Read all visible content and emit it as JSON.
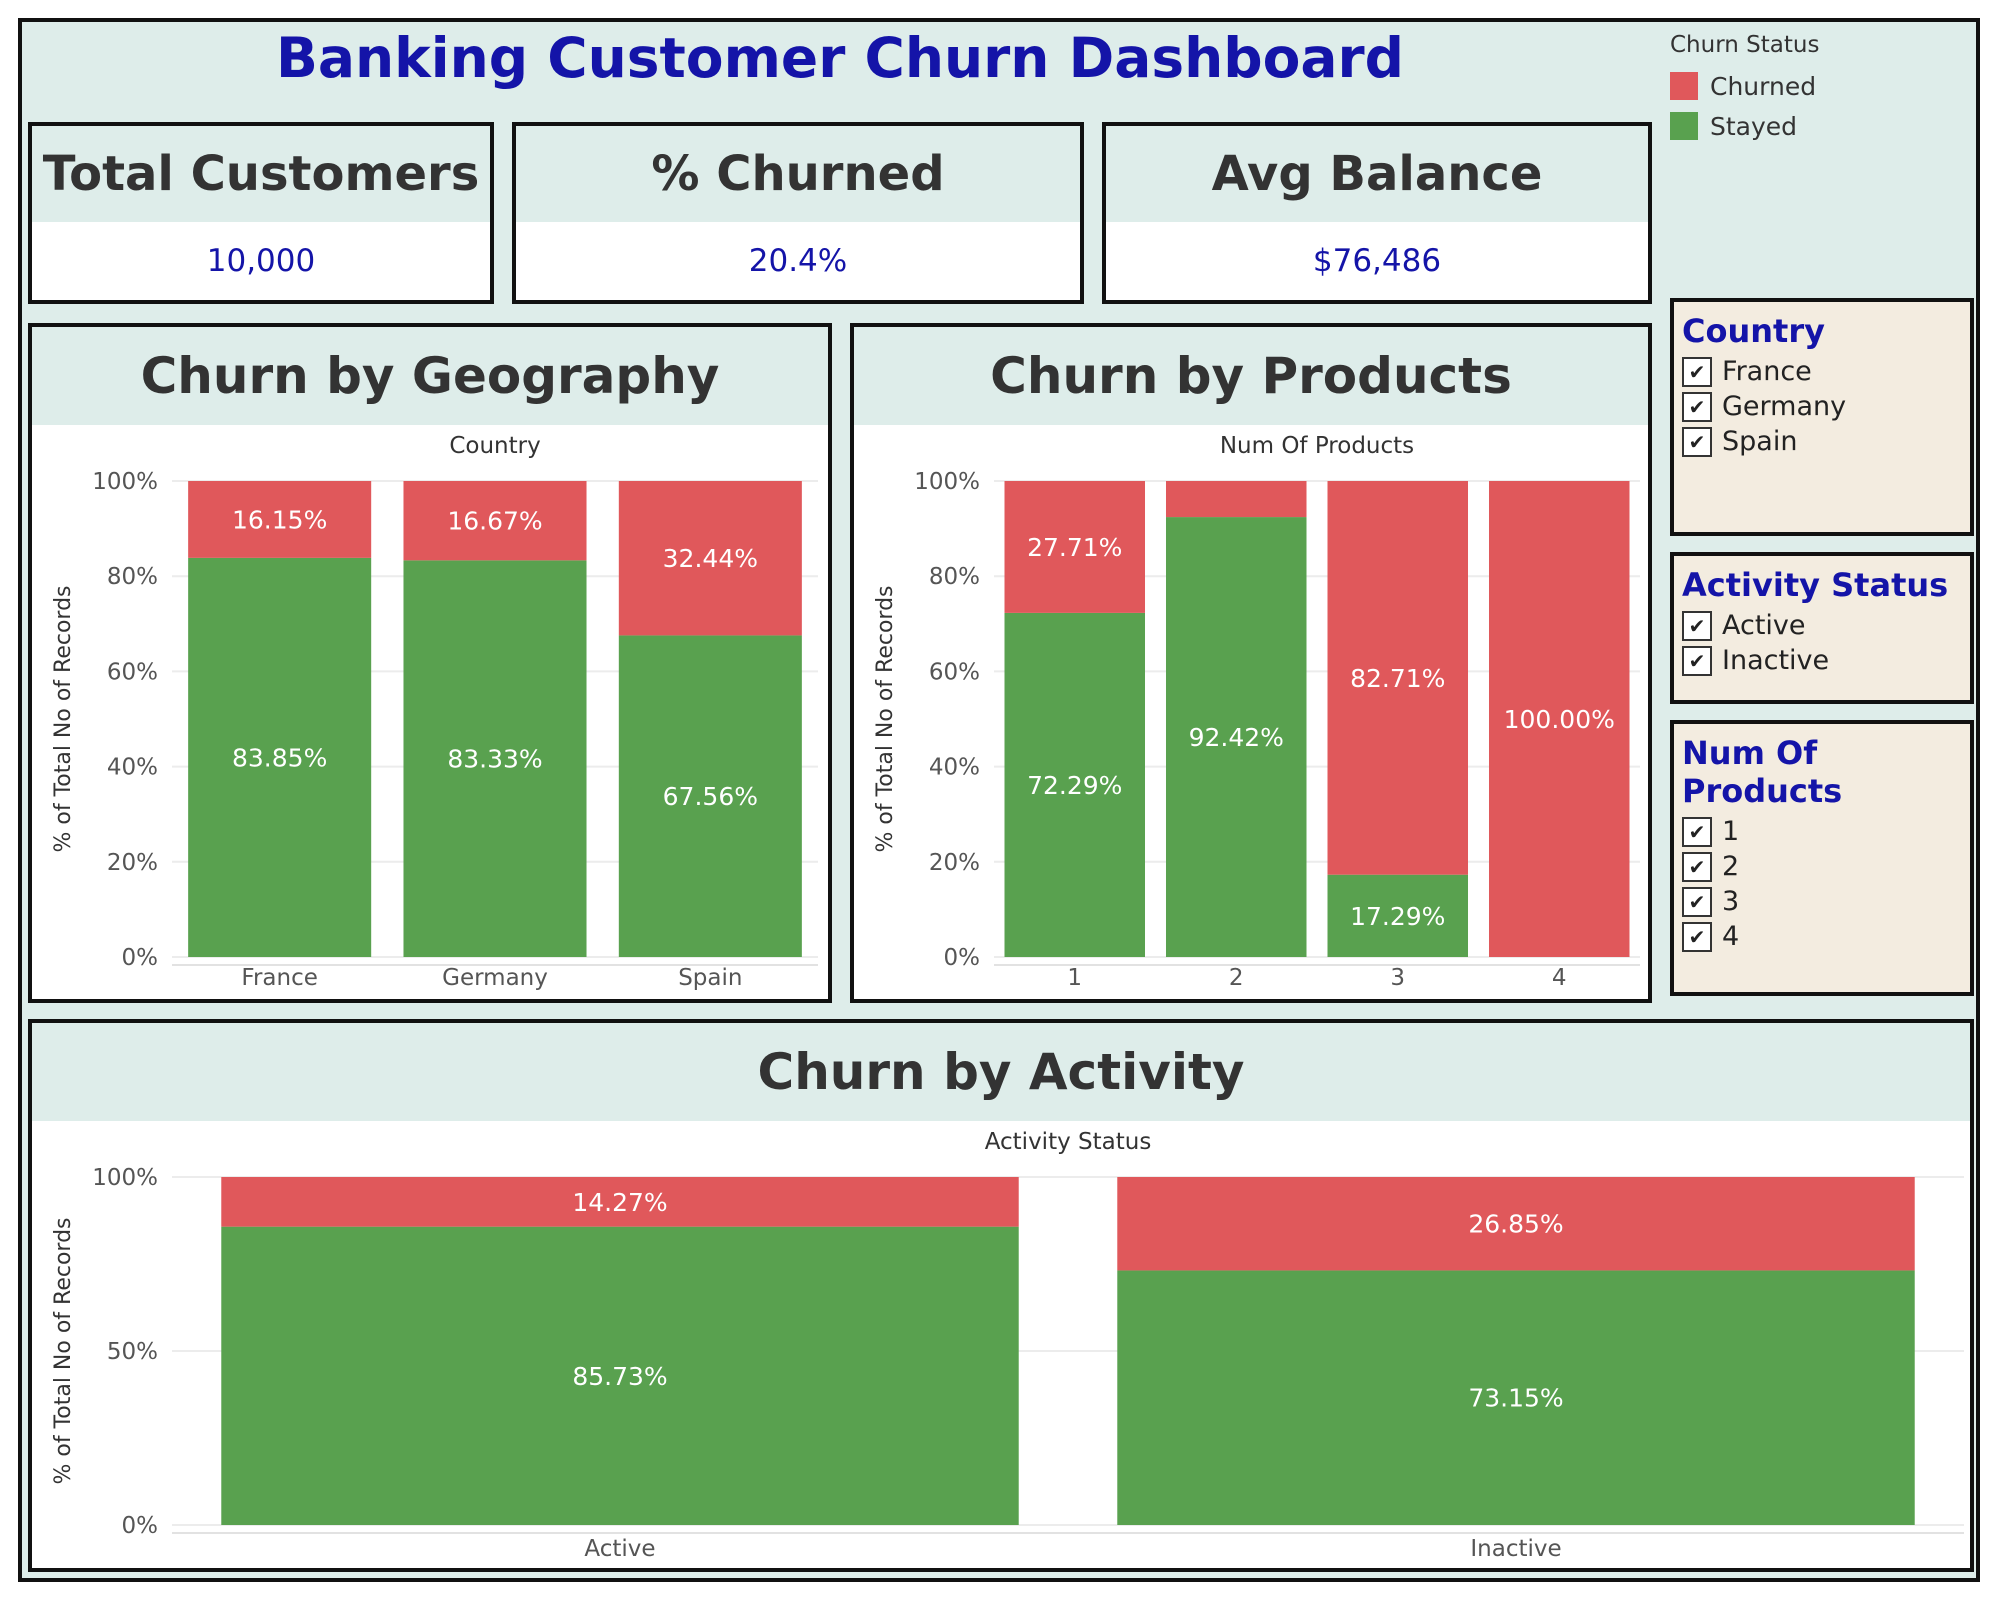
{
  "dashboard": {
    "title": "Banking Customer Churn Dashboard"
  },
  "legend": {
    "title": "Churn Status",
    "items": [
      {
        "label": "Churned",
        "color": "#e0585b"
      },
      {
        "label": "Stayed",
        "color": "#59a14f"
      }
    ]
  },
  "kpis": [
    {
      "label": "Total Customers",
      "value": "10,000"
    },
    {
      "label": "% Churned",
      "value": "20.4%"
    },
    {
      "label": "Avg Balance",
      "value": "$76,486"
    }
  ],
  "filters": [
    {
      "title": "Country",
      "items": [
        "France",
        "Germany",
        "Spain"
      ]
    },
    {
      "title": "Activity Status",
      "items": [
        "Active",
        "Inactive"
      ]
    },
    {
      "title": "Num Of Products",
      "items": [
        "1",
        "2",
        "3",
        "4"
      ]
    }
  ],
  "check_glyph": "✔",
  "colors": {
    "churned": "#e0585b",
    "stayed": "#59a14f",
    "accent": "#1414a8",
    "header_bg": "#deedea",
    "filter_bg": "#f3ece0"
  },
  "panels": {
    "geography": {
      "title": "Churn by Geography"
    },
    "products": {
      "title": "Churn by Products"
    },
    "activity": {
      "title": "Churn by Activity"
    }
  },
  "chart_data": [
    {
      "type": "bar",
      "stacked": true,
      "xlabel": "Country",
      "ylabel": "% of Total No of Records",
      "categories": [
        "France",
        "Germany",
        "Spain"
      ],
      "series": [
        {
          "name": "Stayed",
          "values": [
            83.85,
            83.33,
            67.56
          ],
          "labels": [
            "83.85%",
            "83.33%",
            "67.56%"
          ]
        },
        {
          "name": "Churned",
          "values": [
            16.15,
            16.67,
            32.44
          ],
          "labels": [
            "16.15%",
            "16.67%",
            "32.44%"
          ]
        }
      ],
      "yticks": [
        "0%",
        "20%",
        "40%",
        "60%",
        "80%",
        "100%"
      ],
      "ylim": [
        0,
        100
      ],
      "grid": true
    },
    {
      "type": "bar",
      "stacked": true,
      "xlabel": "Num Of Products",
      "ylabel": "% of Total No of Records",
      "categories": [
        "1",
        "2",
        "3",
        "4"
      ],
      "series": [
        {
          "name": "Stayed",
          "values": [
            72.29,
            92.42,
            17.29,
            0
          ],
          "labels": [
            "72.29%",
            "92.42%",
            "17.29%",
            ""
          ]
        },
        {
          "name": "Churned",
          "values": [
            27.71,
            7.58,
            82.71,
            100
          ],
          "labels": [
            "27.71%",
            "",
            "82.71%",
            "100.00%"
          ]
        }
      ],
      "yticks": [
        "0%",
        "20%",
        "40%",
        "60%",
        "80%",
        "100%"
      ],
      "ylim": [
        0,
        100
      ],
      "grid": true
    },
    {
      "type": "bar",
      "stacked": true,
      "xlabel": "Activity Status",
      "ylabel": "% of Total No of Records",
      "categories": [
        "Active",
        "Inactive"
      ],
      "series": [
        {
          "name": "Stayed",
          "values": [
            85.73,
            73.15
          ],
          "labels": [
            "85.73%",
            "73.15%"
          ]
        },
        {
          "name": "Churned",
          "values": [
            14.27,
            26.85
          ],
          "labels": [
            "14.27%",
            "26.85%"
          ]
        }
      ],
      "yticks": [
        "0%",
        "50%",
        "100%"
      ],
      "ylim": [
        0,
        100
      ],
      "grid": true
    }
  ]
}
